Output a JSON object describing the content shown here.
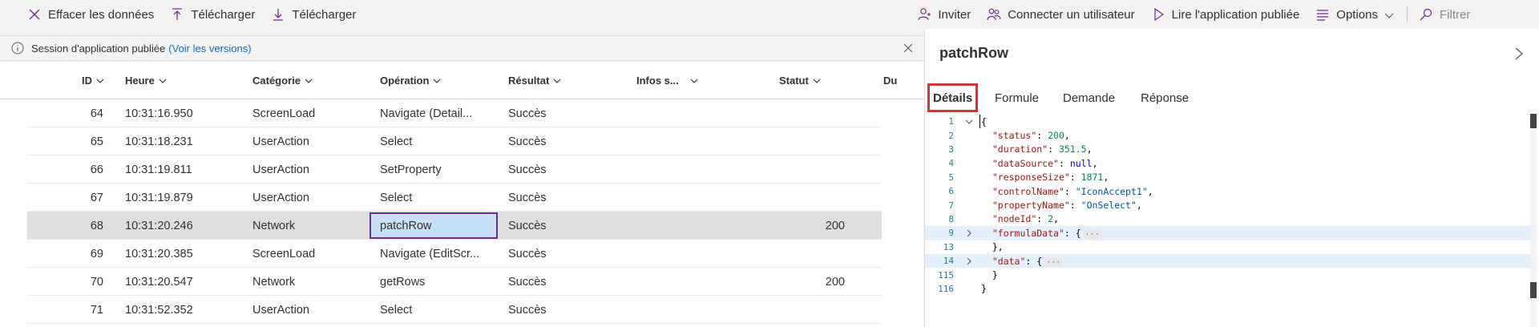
{
  "toolbar": {
    "clear_data": "Effacer les données",
    "upload": "Télécharger",
    "download": "Télécharger",
    "invite": "Inviter",
    "connect_user": "Connecter un utilisateur",
    "play_published": "Lire l'application publiée",
    "options": "Options",
    "filter": "Filtrer"
  },
  "infobar": {
    "message": "Session d'application publiée",
    "link": "(Voir les versions)"
  },
  "table": {
    "columns": [
      "ID",
      "Heure",
      "Catégorie",
      "Opération",
      "Résultat",
      "Infos s...",
      "Statut",
      "Du"
    ],
    "rows": [
      {
        "id": "64",
        "time": "10:31:16.950",
        "category": "ScreenLoad",
        "operation": "Navigate (Detail...",
        "result": "Succès",
        "info": "",
        "status": ""
      },
      {
        "id": "65",
        "time": "10:31:18.231",
        "category": "UserAction",
        "operation": "Select",
        "result": "Succès",
        "info": "",
        "status": ""
      },
      {
        "id": "66",
        "time": "10:31:19.811",
        "category": "UserAction",
        "operation": "SetProperty",
        "result": "Succès",
        "info": "",
        "status": ""
      },
      {
        "id": "67",
        "time": "10:31:19.879",
        "category": "UserAction",
        "operation": "Select",
        "result": "Succès",
        "info": "",
        "status": ""
      },
      {
        "id": "68",
        "time": "10:31:20.246",
        "category": "Network",
        "operation": "patchRow",
        "result": "Succès",
        "info": "",
        "status": "200"
      },
      {
        "id": "69",
        "time": "10:31:20.385",
        "category": "ScreenLoad",
        "operation": "Navigate (EditScr...",
        "result": "Succès",
        "info": "",
        "status": ""
      },
      {
        "id": "70",
        "time": "10:31:20.547",
        "category": "Network",
        "operation": "getRows",
        "result": "Succès",
        "info": "",
        "status": "200"
      },
      {
        "id": "71",
        "time": "10:31:52.352",
        "category": "UserAction",
        "operation": "Select",
        "result": "Succès",
        "info": "",
        "status": ""
      }
    ]
  },
  "panel": {
    "title": "patchRow",
    "tabs": [
      "Détails",
      "Formule",
      "Demande",
      "Réponse"
    ],
    "active_tab": "Détails"
  },
  "editor": {
    "lines": [
      {
        "num": "1",
        "fold": "open",
        "parts": [
          {
            "t": "p",
            "v": "{"
          }
        ]
      },
      {
        "num": "2",
        "parts": [
          {
            "t": "p",
            "v": "  "
          },
          {
            "t": "k",
            "v": "\"status\""
          },
          {
            "t": "p",
            "v": ": "
          },
          {
            "t": "n",
            "v": "200"
          },
          {
            "t": "p",
            "v": ","
          }
        ]
      },
      {
        "num": "3",
        "parts": [
          {
            "t": "p",
            "v": "  "
          },
          {
            "t": "k",
            "v": "\"duration\""
          },
          {
            "t": "p",
            "v": ": "
          },
          {
            "t": "n",
            "v": "351.5"
          },
          {
            "t": "p",
            "v": ","
          }
        ]
      },
      {
        "num": "4",
        "parts": [
          {
            "t": "p",
            "v": "  "
          },
          {
            "t": "k",
            "v": "\"dataSource\""
          },
          {
            "t": "p",
            "v": ": "
          },
          {
            "t": "kw",
            "v": "null"
          },
          {
            "t": "p",
            "v": ","
          }
        ]
      },
      {
        "num": "5",
        "parts": [
          {
            "t": "p",
            "v": "  "
          },
          {
            "t": "k",
            "v": "\"responseSize\""
          },
          {
            "t": "p",
            "v": ": "
          },
          {
            "t": "n",
            "v": "1871"
          },
          {
            "t": "p",
            "v": ","
          }
        ]
      },
      {
        "num": "6",
        "parts": [
          {
            "t": "p",
            "v": "  "
          },
          {
            "t": "k",
            "v": "\"controlName\""
          },
          {
            "t": "p",
            "v": ": "
          },
          {
            "t": "s",
            "v": "\"IconAccept1\""
          },
          {
            "t": "p",
            "v": ","
          }
        ]
      },
      {
        "num": "7",
        "parts": [
          {
            "t": "p",
            "v": "  "
          },
          {
            "t": "k",
            "v": "\"propertyName\""
          },
          {
            "t": "p",
            "v": ": "
          },
          {
            "t": "s",
            "v": "\"OnSelect\""
          },
          {
            "t": "p",
            "v": ","
          }
        ]
      },
      {
        "num": "8",
        "parts": [
          {
            "t": "p",
            "v": "  "
          },
          {
            "t": "k",
            "v": "\"nodeId\""
          },
          {
            "t": "p",
            "v": ": "
          },
          {
            "t": "n",
            "v": "2"
          },
          {
            "t": "p",
            "v": ","
          }
        ]
      },
      {
        "num": "9",
        "fold": "closed",
        "hl": true,
        "parts": [
          {
            "t": "p",
            "v": "  "
          },
          {
            "t": "k",
            "v": "\"formulaData\""
          },
          {
            "t": "p",
            "v": ": {"
          },
          {
            "t": "e",
            "v": "···"
          }
        ]
      },
      {
        "num": "13",
        "parts": [
          {
            "t": "p",
            "v": "  },"
          }
        ]
      },
      {
        "num": "14",
        "fold": "closed",
        "hl": true,
        "parts": [
          {
            "t": "p",
            "v": "  "
          },
          {
            "t": "k",
            "v": "\"data\""
          },
          {
            "t": "p",
            "v": ": {"
          },
          {
            "t": "e",
            "v": "···"
          }
        ]
      },
      {
        "num": "115",
        "parts": [
          {
            "t": "p",
            "v": "  }"
          }
        ]
      },
      {
        "num": "116",
        "parts": [
          {
            "t": "p",
            "v": "}"
          }
        ]
      }
    ]
  },
  "colors": {
    "accent": "#6b2f8b",
    "selection_row": "#e1dfdd",
    "selected_cell": "#c7e0f4",
    "callout": "#d13438",
    "link": "#0f6cbd"
  }
}
